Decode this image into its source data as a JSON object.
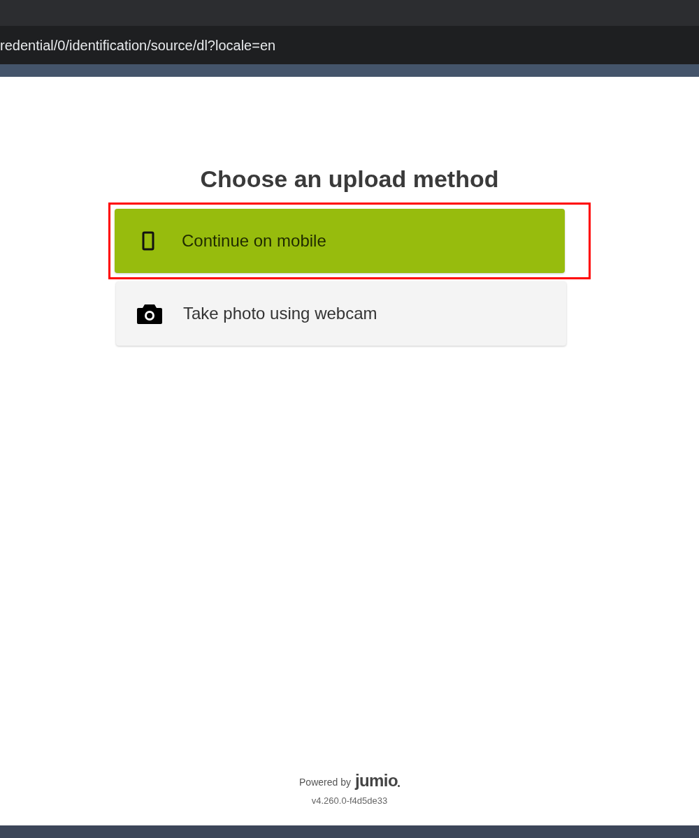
{
  "browser": {
    "address": "redential/0/identification/source/dl?locale=en"
  },
  "heading": "Choose an upload method",
  "options": [
    {
      "kind": "mobile",
      "label": "Continue on mobile",
      "selected": true,
      "highlighted": true
    },
    {
      "kind": "webcam",
      "label": "Take photo using webcam",
      "selected": false,
      "highlighted": false
    }
  ],
  "footer": {
    "powered_by": "Powered by",
    "brand": "jumio",
    "version": "v4.260.0-f4d5de33"
  }
}
